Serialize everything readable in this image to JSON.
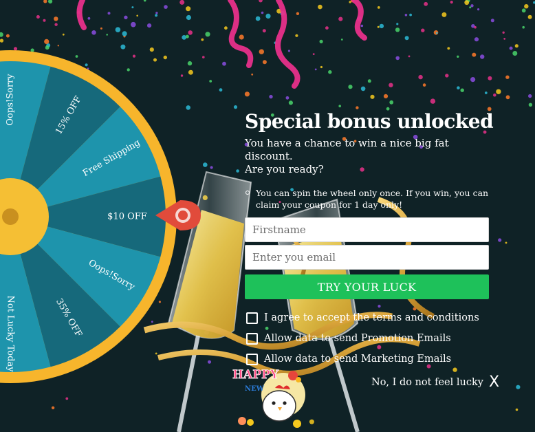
{
  "colors": {
    "background": "#0f2226",
    "wheel_light": "#1e94ac",
    "wheel_dark": "#16697b",
    "wheel_rim": "#f7b52c",
    "button": "#1ec15a",
    "pointer": "#e14b3b"
  },
  "wheel": {
    "segments": [
      {
        "label": "Oops!Sorry"
      },
      {
        "label": "15% OFF"
      },
      {
        "label": "Free Shipping"
      },
      {
        "label": "$10 OFF"
      },
      {
        "label": "Oops!Sorry"
      },
      {
        "label": "35% OFF"
      },
      {
        "label": "Not Lucky Today"
      }
    ],
    "pointer_icon": "map-pin-icon"
  },
  "popup": {
    "title": "Special bonus unlocked",
    "subtitle_line1": "You have a chance to win a nice big fat discount.",
    "subtitle_line2": "Are you ready?",
    "rules": [
      {
        "text": "You can spin the wheel only once. If you win, you can claim your coupon for 1 day only!"
      }
    ],
    "firstname_placeholder": "Firstname",
    "email_placeholder": "Enter you email",
    "cta_label": "TRY YOUR LUCK",
    "checkboxes": [
      {
        "label": "I agree to accept the terms and conditions",
        "checked": false
      },
      {
        "label": "Allow data to send Promotion Emails",
        "checked": false
      },
      {
        "label": "Allow data to send Marketing Emails",
        "checked": false
      }
    ],
    "decline_label": "No, I do not feel lucky",
    "close_glyph": "X"
  },
  "mascot": {
    "sign_text": "HAPPY",
    "sign_subtext": "NEW"
  }
}
